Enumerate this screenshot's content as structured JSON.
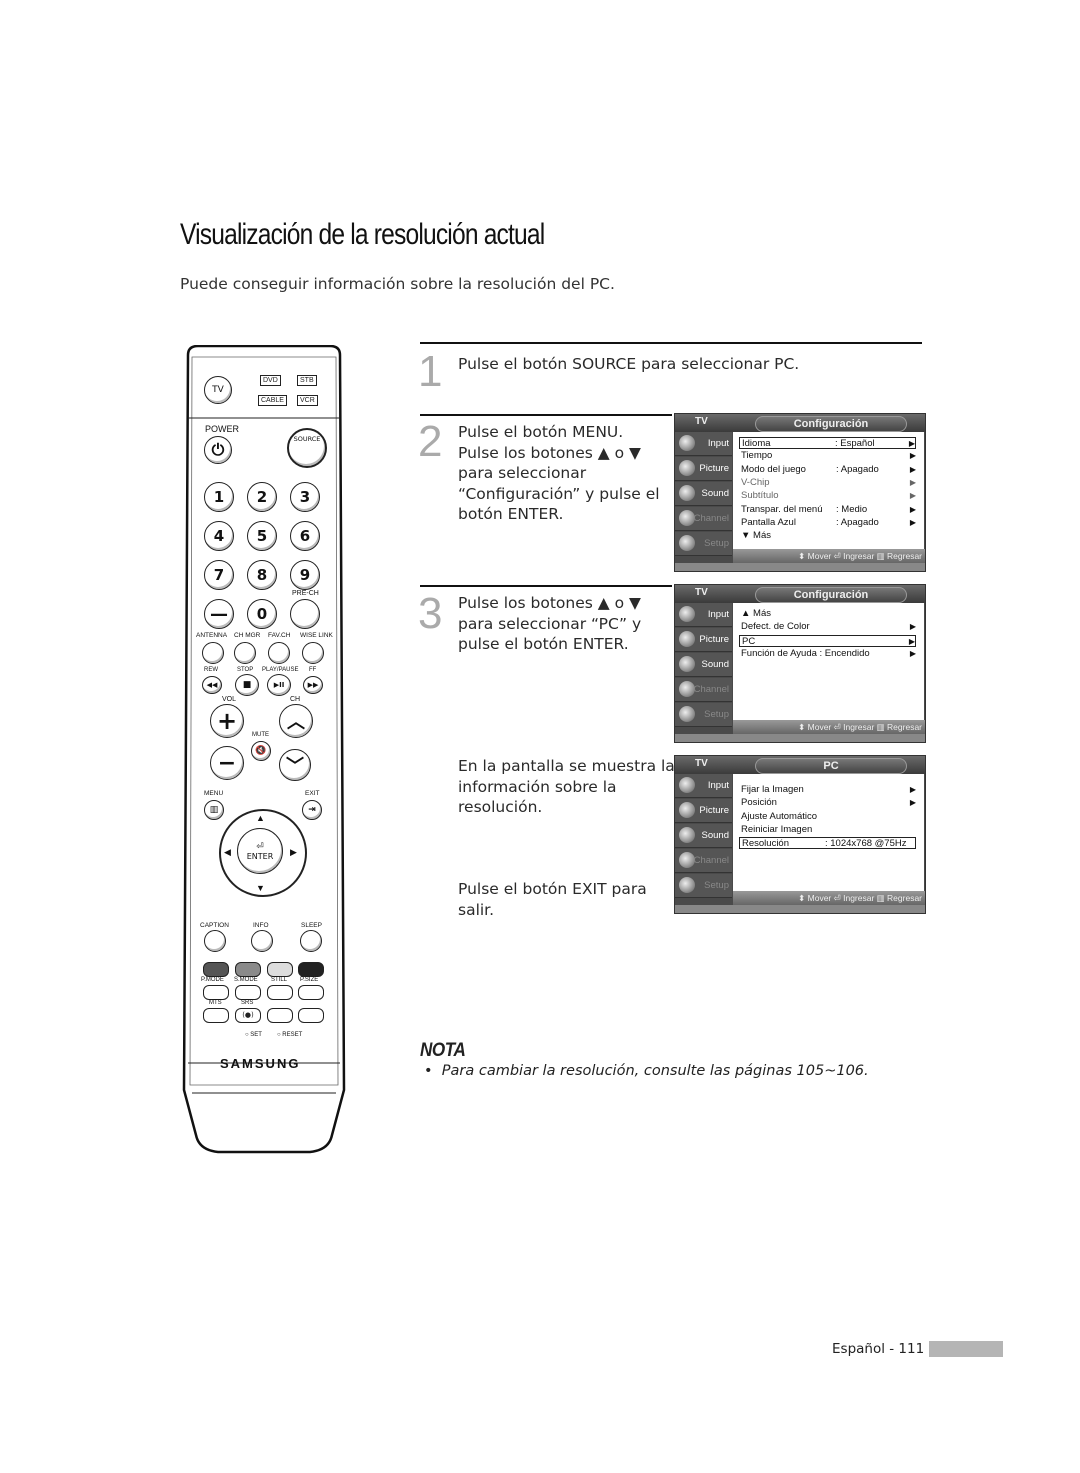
{
  "page": {
    "title": "Visualización de la resolución actual",
    "intro": "Puede conseguir información sobre la resolución del PC.",
    "footer_label": "Español - 111"
  },
  "steps": [
    {
      "number": "1",
      "text": "Pulse el botón SOURCE para seleccionar PC."
    },
    {
      "number": "2",
      "lines": [
        "Pulse el botón MENU.",
        "Pulse los botones ▲ o ▼",
        "para seleccionar",
        "“Configuración” y pulse el",
        "botón ENTER."
      ]
    },
    {
      "number": "3",
      "lines": [
        "Pulse los botones ▲ o ▼",
        "para seleccionar “PC” y",
        "pulse el botón ENTER."
      ]
    },
    {
      "number": "",
      "lines": [
        "En la pantalla se muestra la",
        "información sobre la",
        "resolución."
      ]
    },
    {
      "number": "",
      "lines": [
        "Pulse el botón EXIT para",
        "salir."
      ]
    }
  ],
  "nota": {
    "title": "NOTA",
    "bullet": "•",
    "text": "Para cambiar la resolución, consulte las páginas 105~106."
  },
  "tv_common": {
    "source_label": "TV",
    "sidebar": [
      "Input",
      "Picture",
      "Sound",
      "Channel",
      "Setup"
    ],
    "footer": "⬍ Mover  ⏎ Ingresar  ▥ Regresar"
  },
  "screens": [
    {
      "menu_title": "Configuración",
      "rows": [
        {
          "label": "Idioma",
          "value": ": Español",
          "arrow": "▶",
          "selected": true
        },
        {
          "label": "Tiempo",
          "value": "",
          "arrow": "▶"
        },
        {
          "label": "Modo del juego",
          "value": ": Apagado",
          "arrow": "▶"
        },
        {
          "label": "V-Chip",
          "value": "",
          "arrow": "▶",
          "dim": true
        },
        {
          "label": "Subtítulo",
          "value": "",
          "arrow": "▶",
          "dim": true
        },
        {
          "label": "Transpar. del menú",
          "value": ": Medio",
          "arrow": "▶"
        },
        {
          "label": "Pantalla Azul",
          "value": ": Apagado",
          "arrow": "▶"
        },
        {
          "label": "▼ Más",
          "value": "",
          "arrow": ""
        }
      ]
    },
    {
      "menu_title": "Configuración",
      "rows": [
        {
          "label": "▲ Más",
          "value": "",
          "arrow": ""
        },
        {
          "label": "Defect. de Color",
          "value": "",
          "arrow": "▶"
        },
        {
          "label": "PC",
          "value": "",
          "arrow": "▶",
          "selected": true
        },
        {
          "label": "Función de Ayuda : Encendido",
          "value": "",
          "arrow": "▶"
        }
      ]
    },
    {
      "menu_title": "PC",
      "rows": [
        {
          "label": "Fijar la Imagen",
          "value": "",
          "arrow": "▶"
        },
        {
          "label": "Posición",
          "value": "",
          "arrow": "▶"
        },
        {
          "label": "Ajuste Automático",
          "value": "",
          "arrow": ""
        },
        {
          "label": "Reiniciar Imagen",
          "value": "",
          "arrow": ""
        },
        {
          "label": "Resolución",
          "value": ": 1024x768 @75Hz",
          "arrow": "",
          "selected": true
        }
      ]
    }
  ],
  "remote": {
    "mode_buttons": {
      "tv": "TV",
      "dvd": "DVD",
      "stb": "STB",
      "cable": "CABLE",
      "vcr": "VCR"
    },
    "power": "POWER",
    "source": "SOURCE",
    "digits": [
      "1",
      "2",
      "3",
      "4",
      "5",
      "6",
      "7",
      "8",
      "9",
      "—",
      "0",
      ""
    ],
    "pre_ch": "PRE-CH",
    "row_labels": [
      "ANTENNA",
      "CH MGR",
      "FAV.CH",
      "WISE LINK"
    ],
    "transport_labels": [
      "REW",
      "STOP",
      "PLAY/PAUSE",
      "FF"
    ],
    "transport_icons": [
      "◀◀",
      "■",
      "▶II",
      "▶▶"
    ],
    "vol": "VOL",
    "ch": "CH",
    "mute": "MUTE",
    "menu": "MENU",
    "exit": "EXIT",
    "enter": "ENTER",
    "bottom_labels": [
      "CAPTION",
      "INFO",
      "SLEEP"
    ],
    "color_labels": [
      "P.MODE",
      "S.MODE",
      "STILL",
      "P.SIZE"
    ],
    "color_button_colors": [
      "#555555",
      "#8a8a8a",
      "#dddddd",
      "#222222"
    ],
    "mts": "MTS",
    "srs": "SRS",
    "srs_icon": "(●)",
    "set": "SET",
    "reset": "RESET",
    "brand": "SAMSUNG"
  }
}
